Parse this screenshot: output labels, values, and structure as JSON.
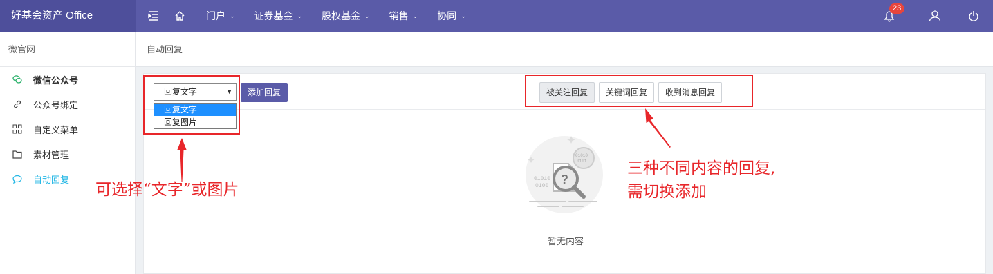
{
  "app": {
    "title": "好基会资产 Office"
  },
  "topnav": {
    "items": [
      {
        "label": "门户"
      },
      {
        "label": "证券基金"
      },
      {
        "label": "股权基金"
      },
      {
        "label": "销售"
      },
      {
        "label": "协同"
      }
    ],
    "notification_count": "23"
  },
  "sidebar": {
    "header": "微官网",
    "items": [
      {
        "label": "微信公众号",
        "icon": "chat-icon"
      },
      {
        "label": "公众号绑定",
        "icon": "link-icon"
      },
      {
        "label": "自定义菜单",
        "icon": "grid-icon"
      },
      {
        "label": "素材管理",
        "icon": "folder-icon"
      },
      {
        "label": "自动回复",
        "icon": "comment-icon"
      }
    ]
  },
  "breadcrumb": "自动回复",
  "toolbar": {
    "select_value": "回复文字",
    "options": [
      "回复文字",
      "回复图片"
    ],
    "add_label": "添加回复",
    "tabs": [
      "被关注回复",
      "关键词回复",
      "收到消息回复"
    ]
  },
  "empty": {
    "text": "暂无内容"
  },
  "annotations": {
    "left": "可选择“文字”或图片",
    "right_line1": "三种不同内容的回复,",
    "right_line2": "需切换添加"
  },
  "colors": {
    "topbar": "#5a5ba8",
    "brand": "#4e4f9b",
    "active": "#23b7e5",
    "annotation": "#e8262a"
  }
}
